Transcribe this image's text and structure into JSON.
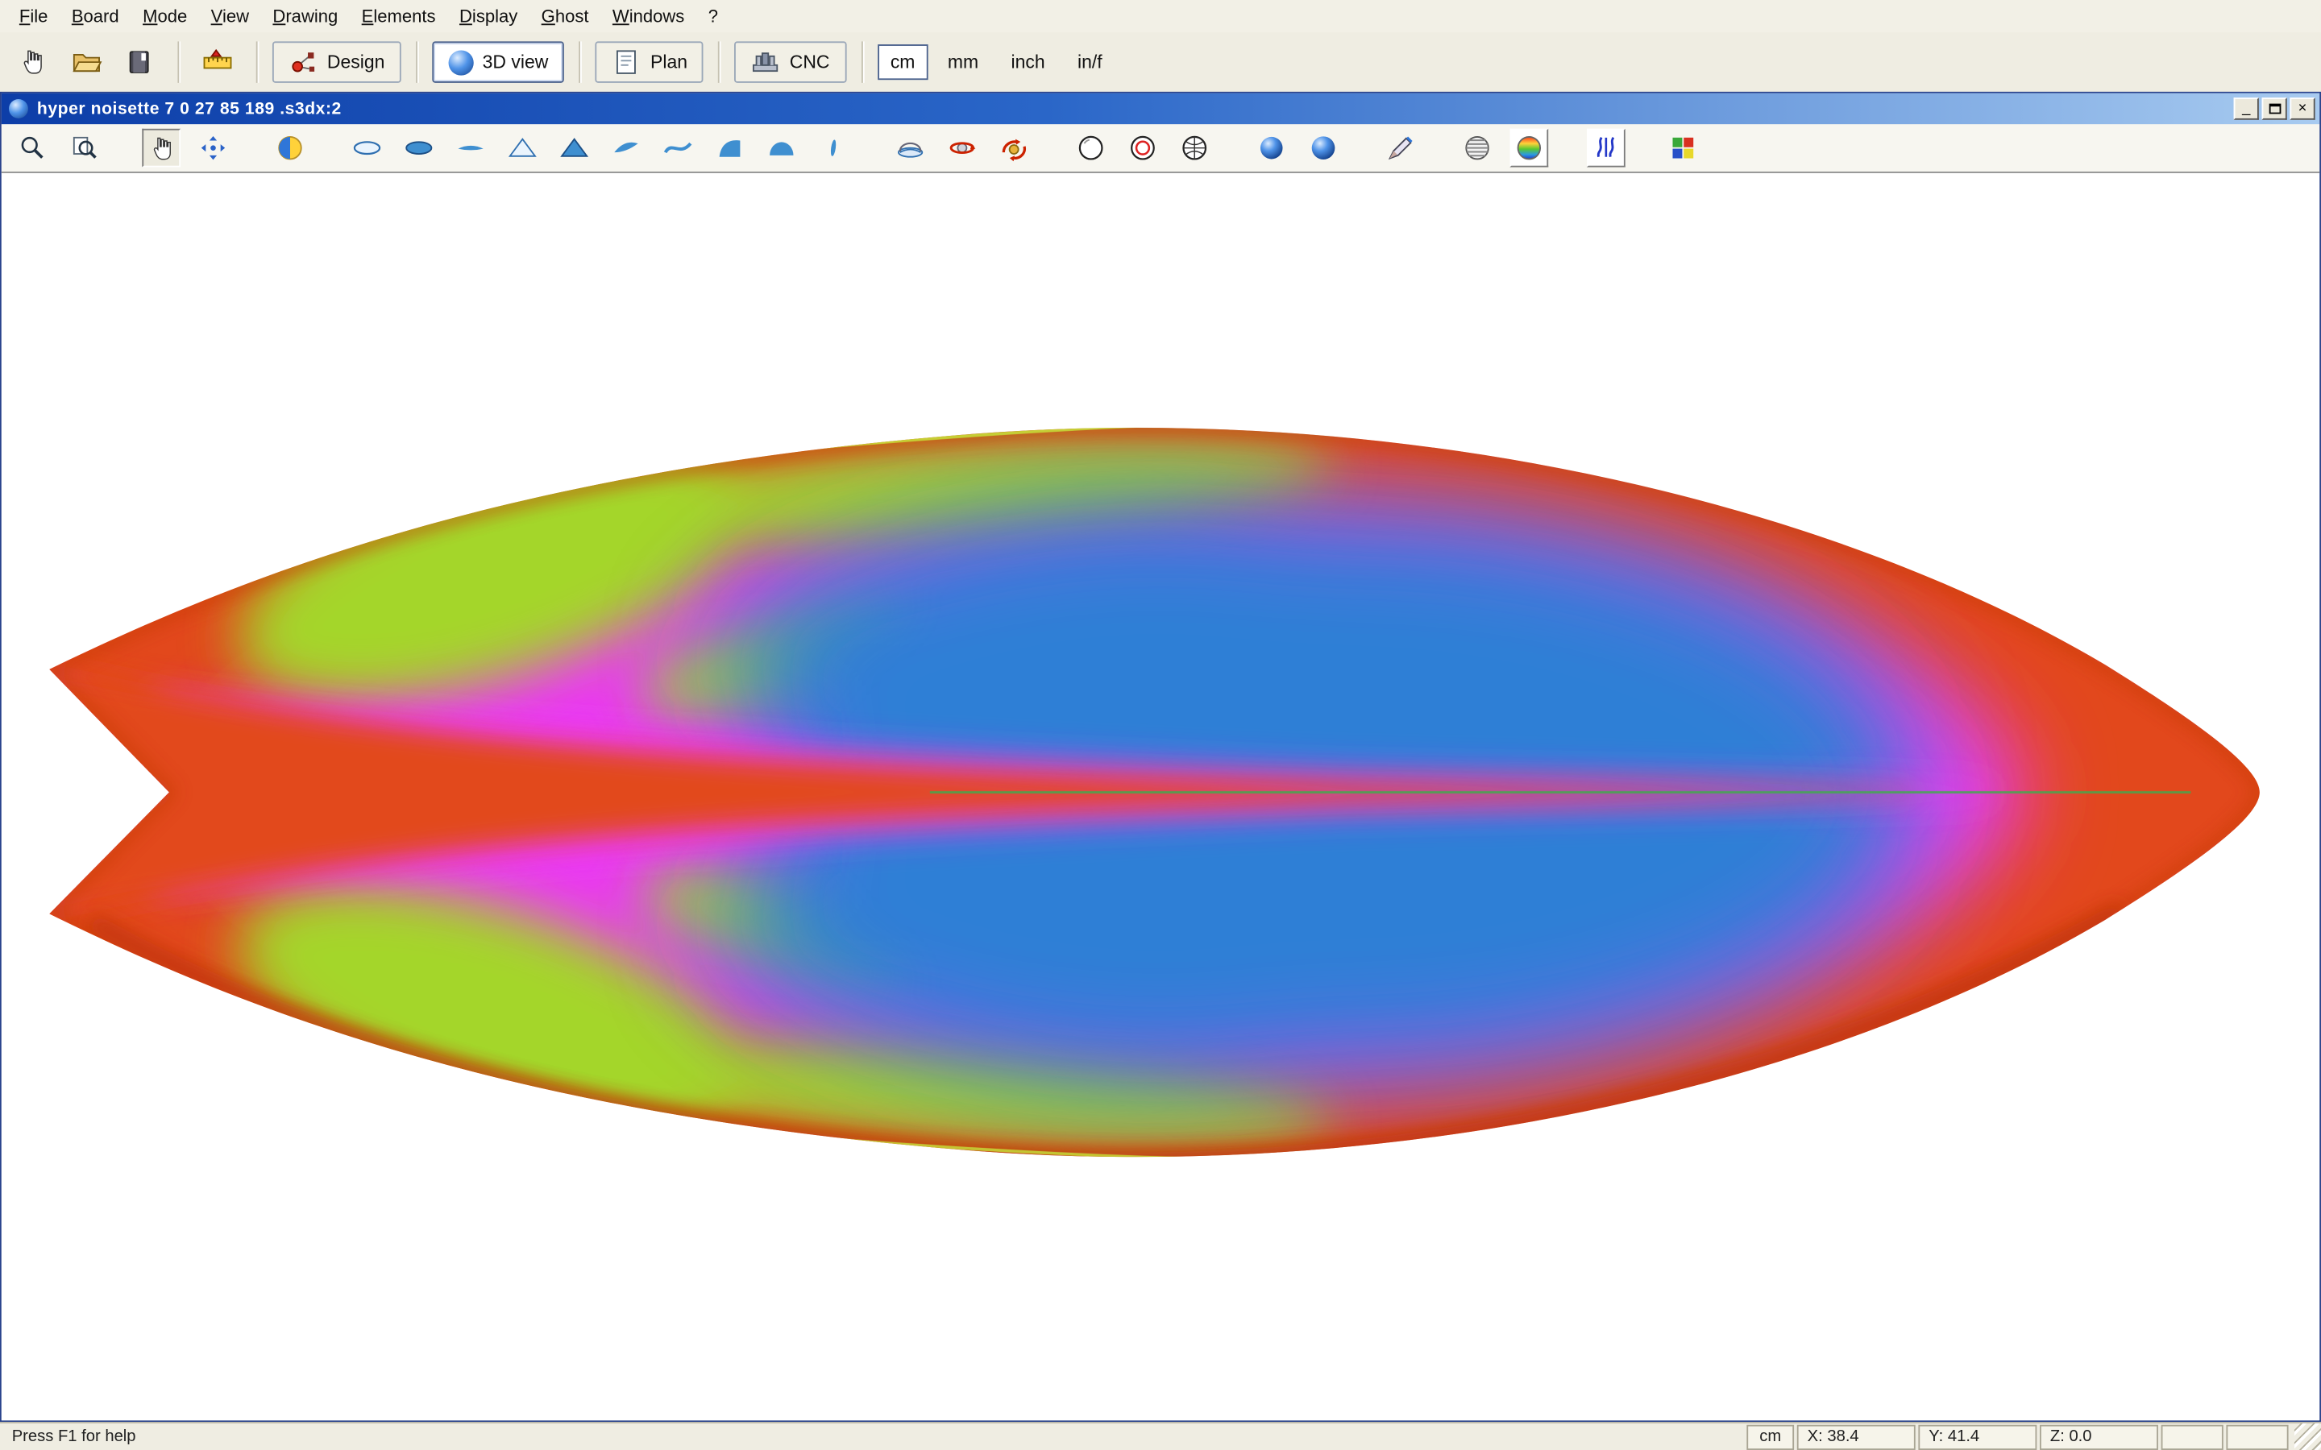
{
  "menu": {
    "items": [
      "File",
      "Board",
      "Mode",
      "View",
      "Drawing",
      "Elements",
      "Display",
      "Ghost",
      "Windows",
      "?"
    ]
  },
  "main_toolbar": {
    "buttons": {
      "design": "Design",
      "view3d": "3D view",
      "plan": "Plan",
      "cnc": "CNC"
    },
    "active_button": "3D view",
    "units": [
      "cm",
      "mm",
      "inch",
      "in/f"
    ],
    "active_unit": "cm"
  },
  "document_window": {
    "title": "hyper noisette 7 0 27 85 189 .s3dx:2",
    "controls": {
      "minimize": "_",
      "close": "×"
    }
  },
  "status_bar": {
    "help_text": "Press F1 for help",
    "unit": "cm",
    "x_value": "X: 38.4",
    "y_value": "Y: 41.4",
    "z_value": "Z: 0.0"
  },
  "board_render": {
    "description": "Top view of surfboard with curvature color map, swallow tail left, nose right",
    "colors": {
      "rail_orange": "#e2481c",
      "map_green": "#a4d62c",
      "map_blue": "#2e7fd6",
      "map_magenta": "#ea3bf0"
    }
  }
}
